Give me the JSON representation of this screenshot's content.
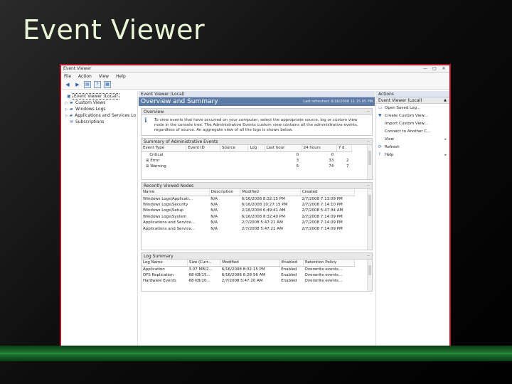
{
  "slide": {
    "title": "Event Viewer"
  },
  "window": {
    "title": "Event Viewer",
    "buttons": {
      "min": "—",
      "max": "□",
      "close": "✕"
    }
  },
  "menu": [
    "File",
    "Action",
    "View",
    "Help"
  ],
  "tree": [
    {
      "label": "Event Viewer (Local)",
      "level": "root",
      "expander": "",
      "icon": "event-viewer-icon",
      "selected": true
    },
    {
      "label": "Custom Views",
      "level": "child",
      "expander": "▷",
      "icon": "folder-icon"
    },
    {
      "label": "Windows Logs",
      "level": "child",
      "expander": "▷",
      "icon": "folder-icon"
    },
    {
      "label": "Applications and Services Lo",
      "level": "child",
      "expander": "▷",
      "icon": "folder-icon"
    },
    {
      "label": "Subscriptions",
      "level": "child",
      "expander": "",
      "icon": "subscription-icon"
    }
  ],
  "center": {
    "header": "Event Viewer (Local)",
    "banner_title": "Overview and Summary",
    "banner_refreshed": "Last refreshed: 6/16/2008 11:15:05 PM",
    "overview": {
      "title": "Overview",
      "text": "To view events that have occurred on your computer, select the appropriate source, log or custom view node in the console tree. The Administrative Events custom view contains all the administrative events, regardless of source. An aggregate view of all the logs is shown below."
    },
    "admin_summary": {
      "title": "Summary of Administrative Events",
      "columns": [
        "Event Type",
        "Event ID",
        "Source",
        "Log",
        "Last hour",
        "24 hours",
        "7 d"
      ],
      "rows": [
        {
          "type": "Critical",
          "id": "",
          "source": "",
          "log": "",
          "hour": "0",
          "day": "0",
          "week": ""
        },
        {
          "type": "Error",
          "id": "",
          "source": "",
          "log": "",
          "hour": "3",
          "day": "33",
          "week": "2"
        },
        {
          "type": "Warning",
          "id": "",
          "source": "",
          "log": "",
          "hour": "5",
          "day": "74",
          "week": "7"
        }
      ]
    },
    "recent_nodes": {
      "title": "Recently Viewed Nodes",
      "columns": [
        "Name",
        "Description",
        "Modified",
        "Created"
      ],
      "rows": [
        {
          "name": "Windows Logs\\Applicati...",
          "desc": "N/A",
          "modified": "6/16/2008 8:32:15 PM",
          "created": "2/7/2008 7:13:09 PM"
        },
        {
          "name": "Windows Logs\\Security",
          "desc": "N/A",
          "modified": "6/16/2008 10:27:15 PM",
          "created": "2/7/2008 7:14:10 PM"
        },
        {
          "name": "Windows Logs\\Setup",
          "desc": "N/A",
          "modified": "2/16/2008 6:49:41 AM",
          "created": "2/7/2008 5:47:34 AM"
        },
        {
          "name": "Windows Logs\\System",
          "desc": "N/A",
          "modified": "6/16/2008 8:32:40 PM",
          "created": "2/7/2008 7:14:09 PM"
        },
        {
          "name": "Applications and Service...",
          "desc": "N/A",
          "modified": "2/7/2008 5:47:21 AM",
          "created": "2/7/2008 7:14:09 PM"
        },
        {
          "name": "Applications and Service...",
          "desc": "N/A",
          "modified": "2/7/2008 5:47:21 AM",
          "created": "2/7/2008 7:14:09 PM"
        }
      ]
    },
    "log_summary": {
      "title": "Log Summary",
      "columns": [
        "Log Name",
        "Size (Curr...",
        "Modified",
        "Enabled",
        "Retention Policy"
      ],
      "rows": [
        {
          "name": "Application",
          "size": "3.07 MB/2...",
          "modified": "6/16/2008 8:32:15 PM",
          "enabled": "Enabled",
          "policy": "Overwrite events..."
        },
        {
          "name": "DFS Replication",
          "size": "68 KB/15...",
          "modified": "6/16/2008 6:28:56 AM",
          "enabled": "Enabled",
          "policy": "Overwrite events..."
        },
        {
          "name": "Hardware Events",
          "size": "68 KB/20...",
          "modified": "2/7/2008 5:47:20 AM",
          "enabled": "Enabled",
          "policy": "Overwrite events..."
        }
      ]
    }
  },
  "actions": {
    "header": "Actions",
    "group": "Event Viewer (Local)",
    "items": [
      {
        "label": "Open Saved Log...",
        "icon": "open-log-icon",
        "arrow": ""
      },
      {
        "label": "Create Custom View...",
        "icon": "filter-icon",
        "arrow": ""
      },
      {
        "label": "Import Custom View...",
        "icon": "",
        "arrow": ""
      },
      {
        "label": "Connect to Another C...",
        "icon": "",
        "arrow": ""
      },
      {
        "label": "View",
        "icon": "",
        "arrow": "▸"
      },
      {
        "label": "Refresh",
        "icon": "refresh-icon",
        "arrow": ""
      },
      {
        "label": "Help",
        "icon": "help-icon",
        "arrow": "▸"
      }
    ]
  }
}
